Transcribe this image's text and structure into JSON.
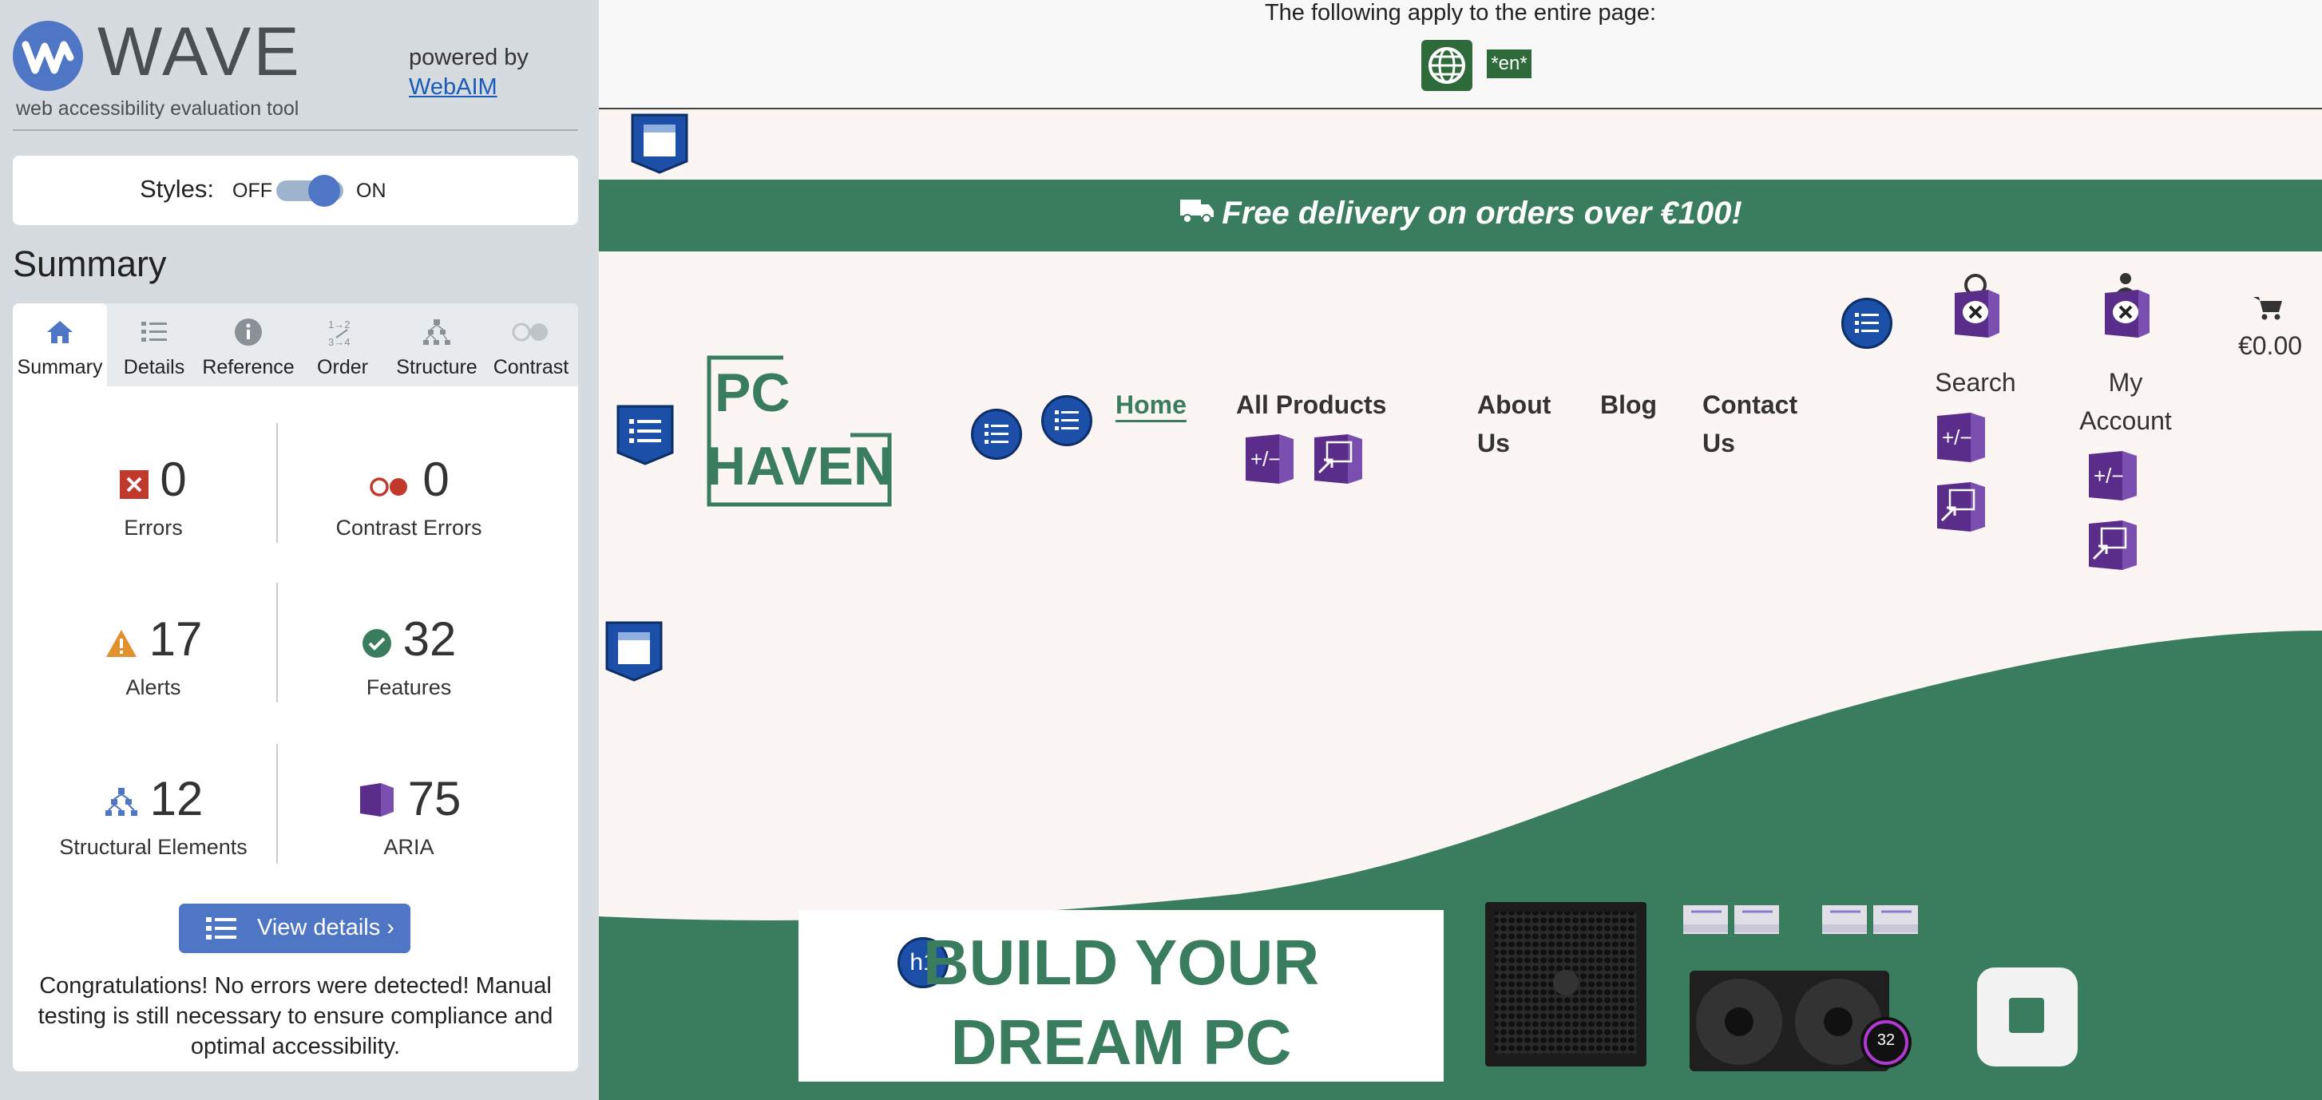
{
  "wave": {
    "logo_text": "WAVE",
    "subtitle": "web accessibility evaluation tool",
    "powered_by": "powered by",
    "webaim_link": "WebAIM",
    "styles_label": "Styles:",
    "off_label": "OFF",
    "on_label": "ON",
    "styles_on": true,
    "summary_heading": "Summary",
    "tabs": [
      {
        "label": "Summary",
        "icon": "home-icon",
        "active": true
      },
      {
        "label": "Details",
        "icon": "list-icon",
        "active": false
      },
      {
        "label": "Reference",
        "icon": "info-icon",
        "active": false
      },
      {
        "label": "Order",
        "icon": "order-icon",
        "active": false
      },
      {
        "label": "Structure",
        "icon": "structure-icon",
        "active": false
      },
      {
        "label": "Contrast",
        "icon": "contrast-icon",
        "active": false
      }
    ],
    "stats": {
      "errors": {
        "count": "0",
        "label": "Errors"
      },
      "contrast_errors": {
        "count": "0",
        "label": "Contrast Errors"
      },
      "alerts": {
        "count": "17",
        "label": "Alerts"
      },
      "features": {
        "count": "32",
        "label": "Features"
      },
      "structural": {
        "count": "12",
        "label": "Structural Elements"
      },
      "aria": {
        "count": "75",
        "label": "ARIA"
      }
    },
    "view_details": "View details ›",
    "congrats": "Congratulations! No errors were detected! Manual testing is still necessary to ensure compliance and optimal accessibility."
  },
  "page_top": {
    "apply_text": "The following apply to the entire page:",
    "lang_badge": "*en*"
  },
  "site": {
    "banner": "Free delivery on orders over €100!",
    "logo_line1": "PC",
    "logo_line2": "HAVEN",
    "nav": {
      "home": "Home",
      "all_products": "All Products",
      "about_1": "About",
      "about_2": "Us",
      "blog": "Blog",
      "contact_1": "Contact",
      "contact_2": "Us"
    },
    "search_label": "Search",
    "account_1": "My",
    "account_2": "Account",
    "cart_total": "€0.00",
    "hero_line1": "BUILD YOUR",
    "hero_line2": "DREAM PC",
    "h1_badge": "h1",
    "cooler_display": "32"
  },
  "colors": {
    "brand_green": "#3a7d5e",
    "wave_blue": "#4f76c4",
    "aria_purple": "#5b2d8a",
    "error_red": "#c0392b",
    "alert_orange": "#e0902c"
  }
}
